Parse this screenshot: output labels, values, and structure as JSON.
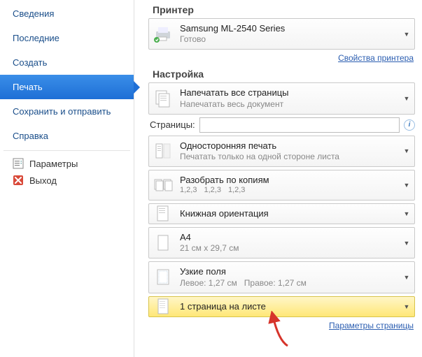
{
  "sidebar": {
    "items": [
      {
        "label": "Сведения"
      },
      {
        "label": "Последние"
      },
      {
        "label": "Создать"
      },
      {
        "label": "Печать"
      },
      {
        "label": "Сохранить и отправить"
      },
      {
        "label": "Справка"
      }
    ],
    "sub": {
      "options": "Параметры",
      "exit": "Выход"
    }
  },
  "printer": {
    "title": "Принтер",
    "name": "Samsung ML-2540 Series",
    "status": "Готово",
    "props_link": "Свойства принтера"
  },
  "settings": {
    "title": "Настройка",
    "scope": {
      "t1": "Напечатать все страницы",
      "t2": "Напечатать весь документ"
    },
    "pages_label": "Страницы:",
    "pages_value": "",
    "duplex": {
      "t1": "Односторонняя печать",
      "t2": "Печатать только на одной стороне листа"
    },
    "collate": {
      "t1": "Разобрать по копиям",
      "seq": "1,2,3"
    },
    "orient": {
      "t1": "Книжная ориентация"
    },
    "paper": {
      "t1": "A4",
      "t2": "21 см x 29,7 см"
    },
    "margins": {
      "t1": "Узкие поля",
      "left": "Левое: 1,27 см",
      "right": "Правое: 1,27 см"
    },
    "sheets": {
      "t1": "1 страница на листе"
    },
    "page_setup_link": "Параметры страницы"
  }
}
